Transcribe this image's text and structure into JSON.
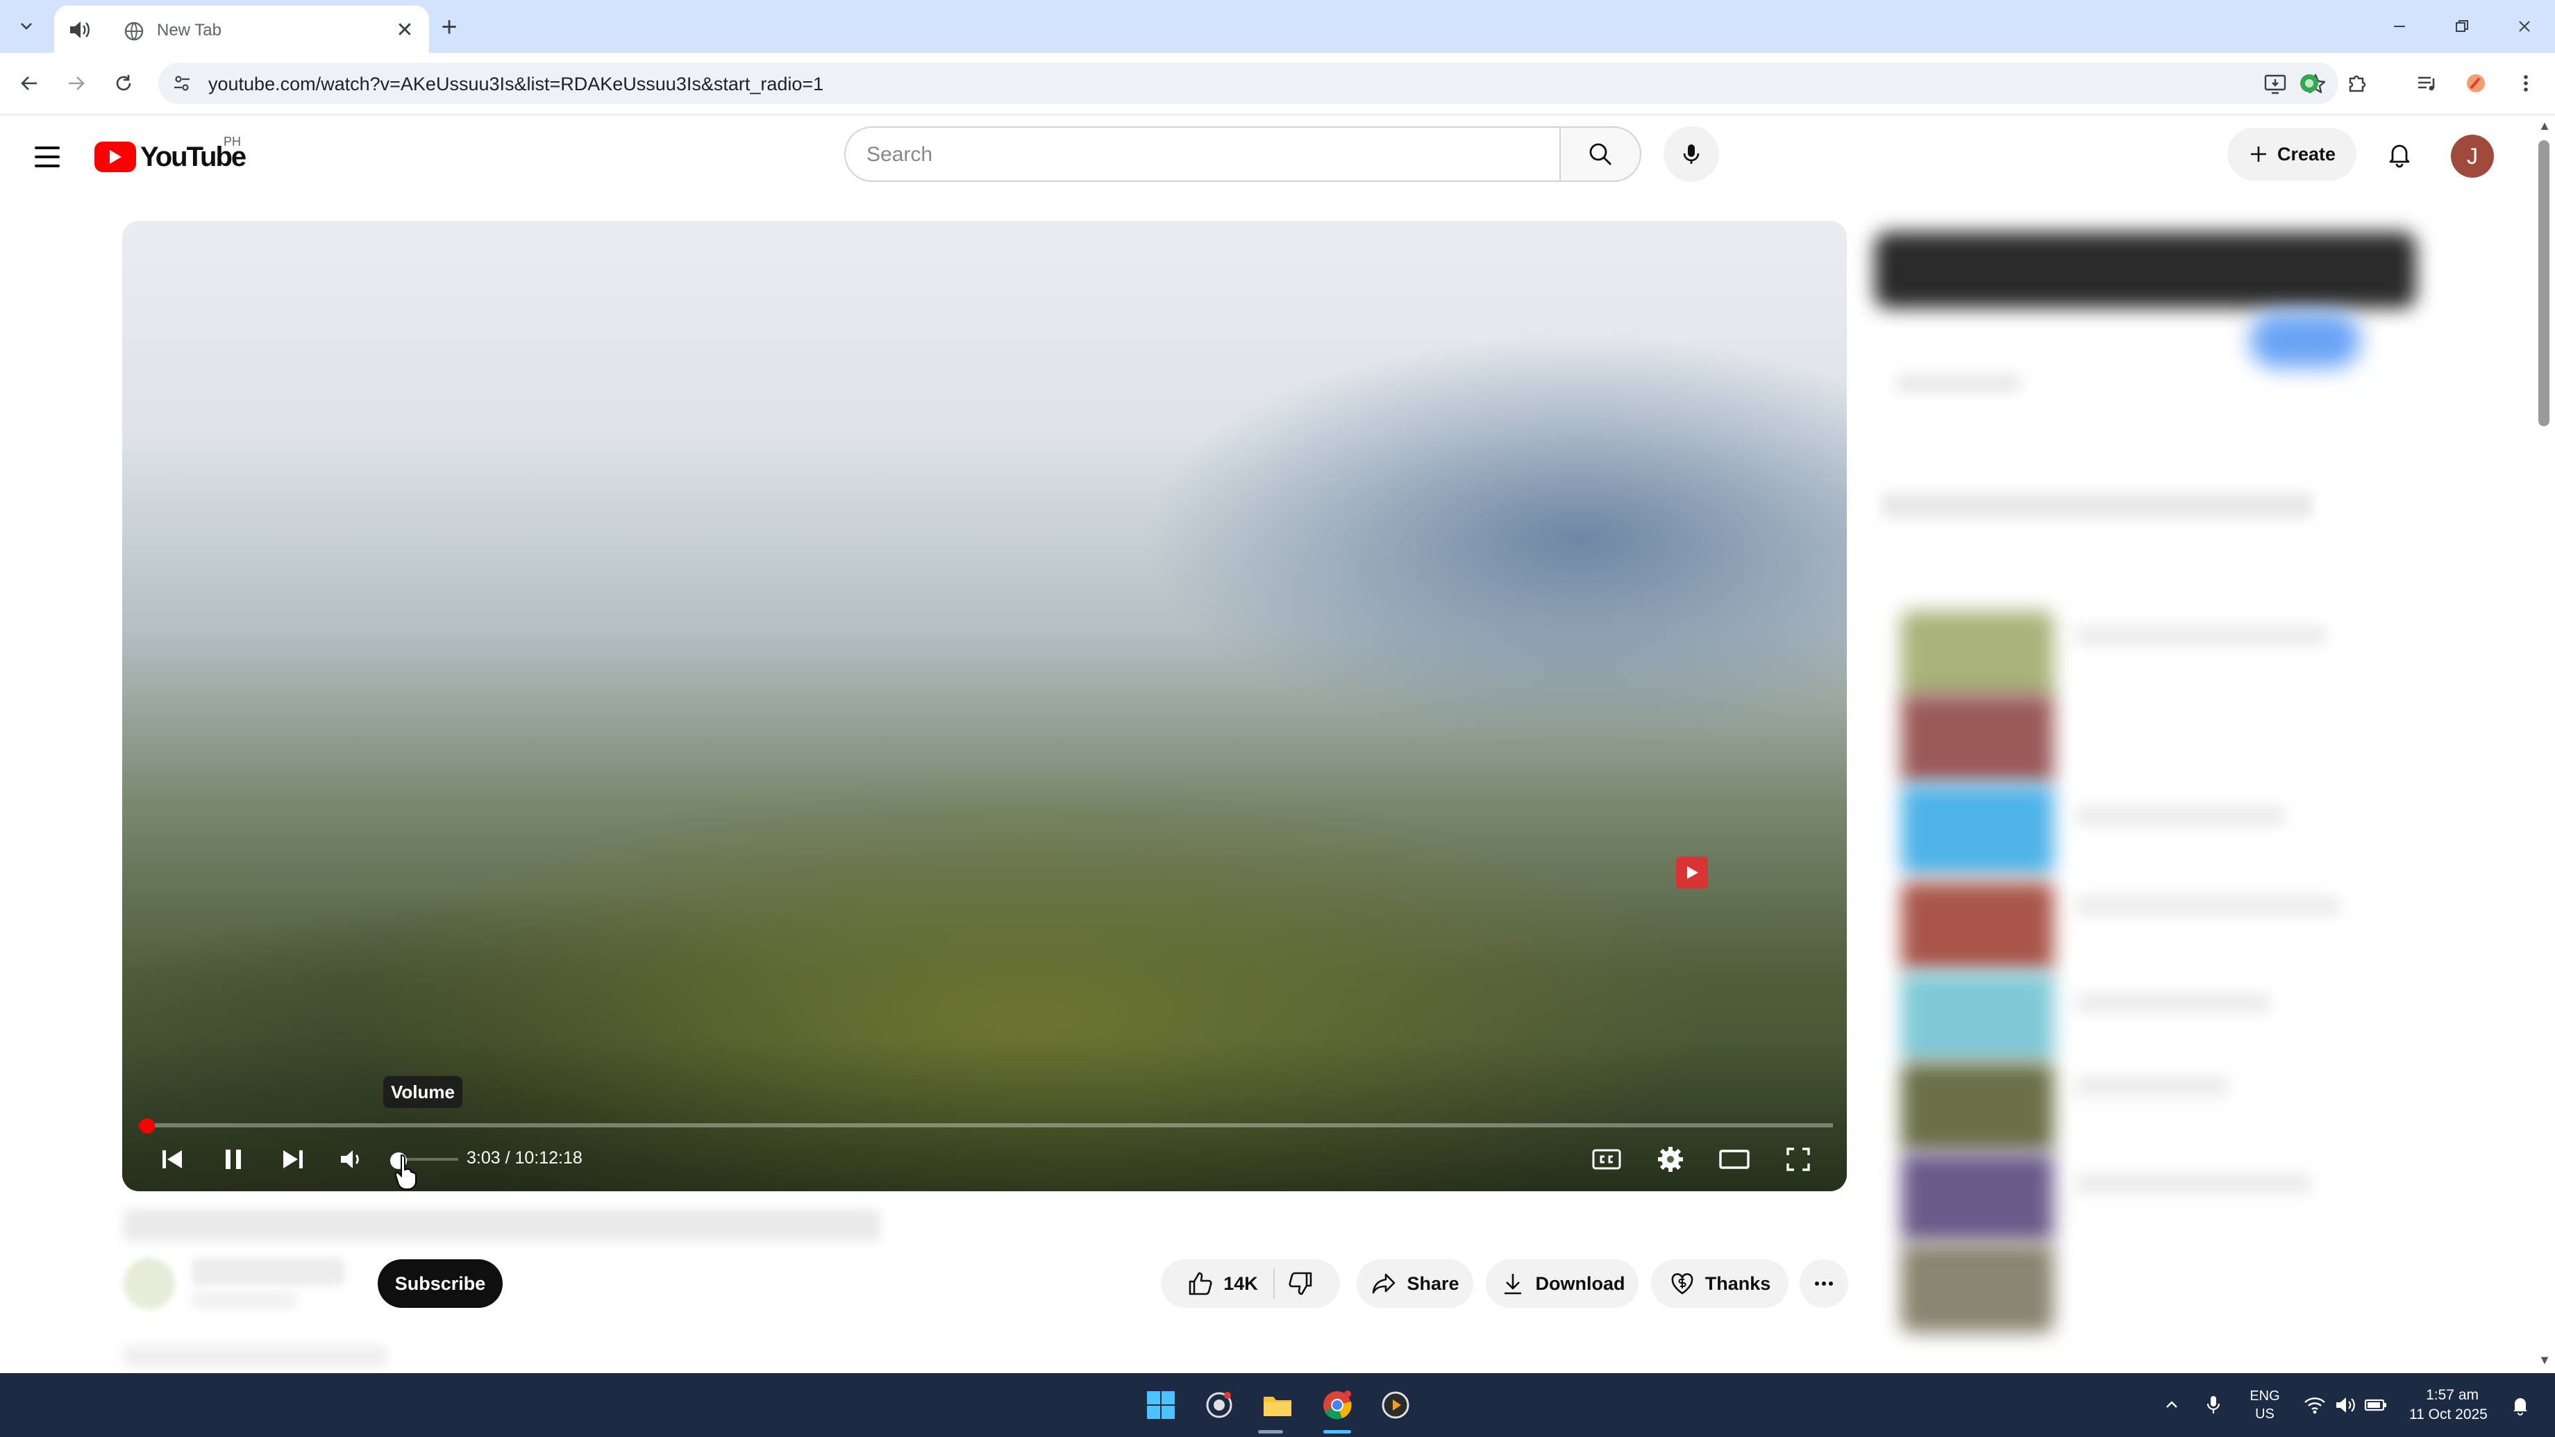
{
  "browser": {
    "tab_title": "New Tab",
    "url": "youtube.com/watch?v=AKeUssuu3Is&list=RDAKeUssuu3Is&start_radio=1"
  },
  "youtube": {
    "logo_text": "YouTube",
    "country_code": "PH",
    "search_placeholder": "Search",
    "create_label": "Create",
    "avatar_initial": "J"
  },
  "player": {
    "tooltip": "Volume",
    "time_display": "3:03 / 10:12:18",
    "progress_fraction": 0.005,
    "volume_fraction": 0.1
  },
  "actions": {
    "subscribe_label": "Subscribe",
    "like_count": "14K",
    "share_label": "Share",
    "download_label": "Download",
    "thanks_label": "Thanks"
  },
  "taskbar": {
    "lang_line1": "ENG",
    "lang_line2": "US",
    "time": "1:57 am",
    "date": "11 Oct 2025"
  },
  "colors": {
    "accent_red": "#ff0000",
    "taskbar_bg": "#1c2a44",
    "tab_strip": "#d3e3fd"
  }
}
